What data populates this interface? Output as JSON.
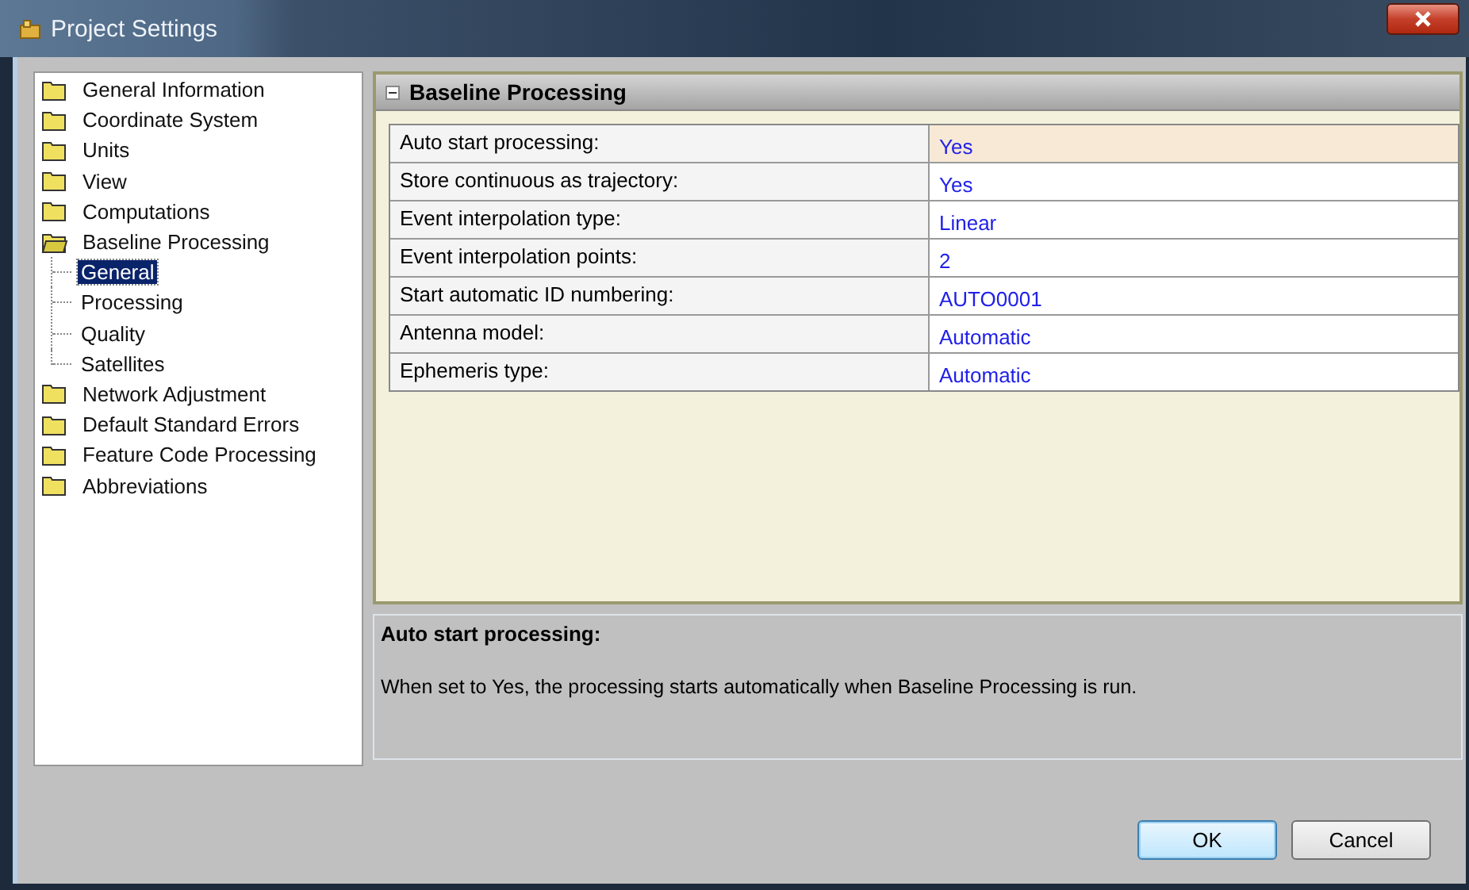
{
  "window": {
    "title": "Project Settings"
  },
  "tree": [
    {
      "label": "General Information",
      "selected": false
    },
    {
      "label": "Coordinate System",
      "selected": false
    },
    {
      "label": "Units",
      "selected": false
    },
    {
      "label": "View",
      "selected": false
    },
    {
      "label": "Computations",
      "selected": false
    },
    {
      "label": "Baseline Processing",
      "selected": false,
      "expanded": true,
      "children": [
        {
          "label": "General",
          "selected": true
        },
        {
          "label": "Processing",
          "selected": false
        },
        {
          "label": "Quality",
          "selected": false
        },
        {
          "label": "Satellites",
          "selected": false
        }
      ]
    },
    {
      "label": "Network Adjustment",
      "selected": false
    },
    {
      "label": "Default Standard Errors",
      "selected": false
    },
    {
      "label": "Feature Code Processing",
      "selected": false
    },
    {
      "label": "Abbreviations",
      "selected": false
    }
  ],
  "grid": {
    "category": "Baseline Processing",
    "expanded": true,
    "rows": [
      {
        "name": "Auto start processing:",
        "value": "Yes",
        "selected": true
      },
      {
        "name": "Store continuous as trajectory:",
        "value": "Yes",
        "selected": false
      },
      {
        "name": "Event interpolation type:",
        "value": "Linear",
        "selected": false
      },
      {
        "name": "Event interpolation points:",
        "value": "2",
        "selected": false
      },
      {
        "name": "Start automatic ID numbering:",
        "value": "AUTO0001",
        "selected": false
      },
      {
        "name": "Antenna model:",
        "value": "Automatic",
        "selected": false
      },
      {
        "name": "Ephemeris type:",
        "value": "Automatic",
        "selected": false
      }
    ]
  },
  "description": {
    "title": "Auto start processing:",
    "text": "When set to Yes, the processing starts automatically when Baseline Processing is run."
  },
  "buttons": [
    {
      "label": "OK",
      "default": true
    },
    {
      "label": "Cancel",
      "default": false
    }
  ]
}
